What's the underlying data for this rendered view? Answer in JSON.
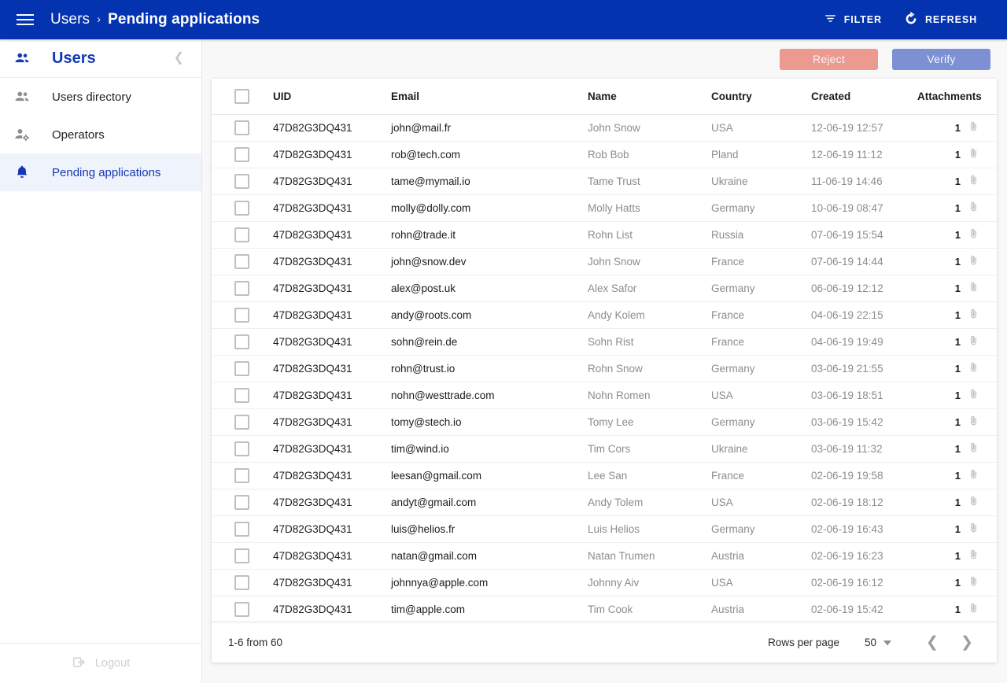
{
  "app_bar": {
    "menu_icon": "hamburger-icon",
    "breadcrumb": {
      "parent": "Users",
      "separator": "›",
      "current": "Pending applications"
    },
    "filter_label": "FILTER",
    "filter_icon": "filter-icon",
    "refresh_label": "REFRESH",
    "refresh_icon": "refresh-icon",
    "background": "#0433b0"
  },
  "sidebar": {
    "title": "Users",
    "title_icon": "people-icon",
    "collapse_icon": "chevron-left-icon",
    "items": [
      {
        "label": "Users directory",
        "icon": "people-icon",
        "active": false
      },
      {
        "label": "Operators",
        "icon": "person-gear-icon",
        "active": false
      },
      {
        "label": "Pending applications",
        "icon": "bell-icon",
        "active": true
      }
    ],
    "logout_label": "Logout",
    "logout_icon": "logout-icon",
    "active_background": "#eff3fc",
    "accent": "#1438b5"
  },
  "toolbar": {
    "reject_label": "Reject",
    "reject_color": "#ec9a90",
    "verify_label": "Verify",
    "verify_color": "#7d90d4"
  },
  "table": {
    "select_all_checkbox": false,
    "columns": [
      "UID",
      "Email",
      "Name",
      "Country",
      "Created",
      "Attachments"
    ],
    "attachment_icon": "paperclip-icon",
    "rows": [
      {
        "uid": "47D82G3DQ431",
        "email": "john@mail.fr",
        "name": "John Snow",
        "country": "USA",
        "created": "12-06-19 12:57",
        "attachments": "1",
        "checked": false
      },
      {
        "uid": "47D82G3DQ431",
        "email": "rob@tech.com",
        "name": "Rob Bob",
        "country": "Pland",
        "created": "12-06-19 11:12",
        "attachments": "1",
        "checked": false
      },
      {
        "uid": "47D82G3DQ431",
        "email": "tame@mymail.io",
        "name": "Tame Trust",
        "country": "Ukraine",
        "created": "11-06-19 14:46",
        "attachments": "1",
        "checked": false
      },
      {
        "uid": "47D82G3DQ431",
        "email": "molly@dolly.com",
        "name": "Molly Hatts",
        "country": "Germany",
        "created": "10-06-19 08:47",
        "attachments": "1",
        "checked": false
      },
      {
        "uid": "47D82G3DQ431",
        "email": "rohn@trade.it",
        "name": "Rohn List",
        "country": "Russia",
        "created": "07-06-19 15:54",
        "attachments": "1",
        "checked": false
      },
      {
        "uid": "47D82G3DQ431",
        "email": "john@snow.dev",
        "name": "John Snow",
        "country": "France",
        "created": "07-06-19 14:44",
        "attachments": "1",
        "checked": false
      },
      {
        "uid": "47D82G3DQ431",
        "email": "alex@post.uk",
        "name": "Alex Safor",
        "country": "Germany",
        "created": "06-06-19 12:12",
        "attachments": "1",
        "checked": false
      },
      {
        "uid": "47D82G3DQ431",
        "email": "andy@roots.com",
        "name": "Andy Kolem",
        "country": "France",
        "created": "04-06-19 22:15",
        "attachments": "1",
        "checked": false
      },
      {
        "uid": "47D82G3DQ431",
        "email": "sohn@rein.de",
        "name": "Sohn Rist",
        "country": "France",
        "created": "04-06-19 19:49",
        "attachments": "1",
        "checked": false
      },
      {
        "uid": "47D82G3DQ431",
        "email": "rohn@trust.io",
        "name": "Rohn Snow",
        "country": "Germany",
        "created": "03-06-19 21:55",
        "attachments": "1",
        "checked": false
      },
      {
        "uid": "47D82G3DQ431",
        "email": "nohn@westtrade.com",
        "name": "Nohn Romen",
        "country": "USA",
        "created": "03-06-19 18:51",
        "attachments": "1",
        "checked": false
      },
      {
        "uid": "47D82G3DQ431",
        "email": "tomy@stech.io",
        "name": "Tomy Lee",
        "country": "Germany",
        "created": "03-06-19 15:42",
        "attachments": "1",
        "checked": false
      },
      {
        "uid": "47D82G3DQ431",
        "email": "tim@wind.io",
        "name": "Tim Cors",
        "country": "Ukraine",
        "created": "03-06-19 11:32",
        "attachments": "1",
        "checked": false
      },
      {
        "uid": "47D82G3DQ431",
        "email": "leesan@gmail.com",
        "name": "Lee San",
        "country": "France",
        "created": "02-06-19 19:58",
        "attachments": "1",
        "checked": false
      },
      {
        "uid": "47D82G3DQ431",
        "email": "andyt@gmail.com",
        "name": "Andy Tolem",
        "country": "USA",
        "created": "02-06-19 18:12",
        "attachments": "1",
        "checked": false
      },
      {
        "uid": "47D82G3DQ431",
        "email": "luis@helios.fr",
        "name": "Luis Helios",
        "country": "Germany",
        "created": "02-06-19 16:43",
        "attachments": "1",
        "checked": false
      },
      {
        "uid": "47D82G3DQ431",
        "email": "natan@gmail.com",
        "name": "Natan Trumen",
        "country": "Austria",
        "created": "02-06-19 16:23",
        "attachments": "1",
        "checked": false
      },
      {
        "uid": "47D82G3DQ431",
        "email": "johnnya@apple.com",
        "name": "Johnny Aiv",
        "country": "USA",
        "created": "02-06-19 16:12",
        "attachments": "1",
        "checked": false
      },
      {
        "uid": "47D82G3DQ431",
        "email": "tim@apple.com",
        "name": "Tim Cook",
        "country": "Austria",
        "created": "02-06-19 15:42",
        "attachments": "1",
        "checked": false
      }
    ]
  },
  "footer": {
    "range_label": "1-6 from 60",
    "rows_per_page_label": "Rows per page",
    "rows_per_page_value": "50",
    "rows_per_page_options": [
      "50"
    ],
    "dropdown_icon": "caret-down-icon",
    "prev_icon": "chevron-left-icon",
    "next_icon": "chevron-right-icon"
  }
}
